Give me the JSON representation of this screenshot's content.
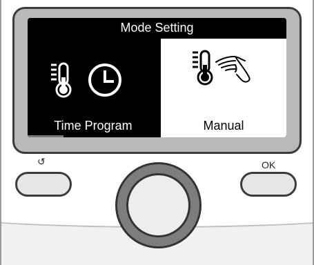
{
  "screen": {
    "title": "Mode Setting",
    "options": [
      {
        "label": "Time Program",
        "icon": "thermometer-clock-icon",
        "selected": false
      },
      {
        "label": "Manual",
        "icon": "thermometer-hand-icon",
        "selected": true
      }
    ]
  },
  "buttons": {
    "back_icon": "↺",
    "ok_label": "OK"
  },
  "colors": {
    "screen_background": "#000000",
    "highlight": "#ffffff",
    "bezel": "#b9b9b9",
    "knob": "#7d7d7d"
  }
}
